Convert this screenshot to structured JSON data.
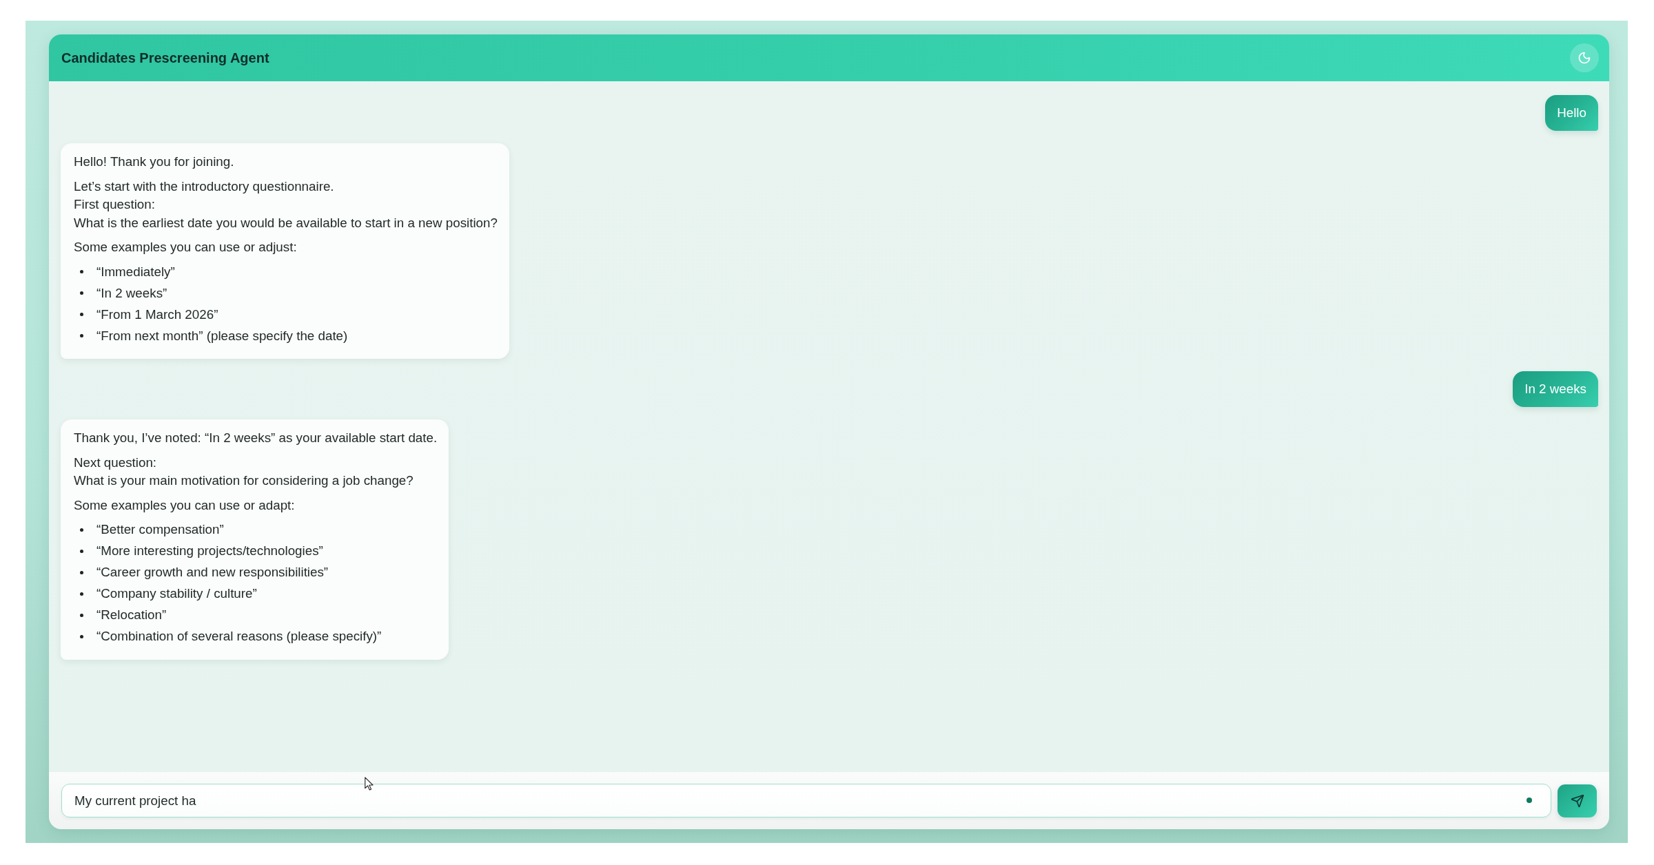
{
  "header": {
    "title": "Candidates Prescreening Agent"
  },
  "messages": [
    {
      "kind": "user",
      "text": "Hello"
    },
    {
      "kind": "agent",
      "blocks": [
        {
          "kind": "paragraph",
          "lines": [
            "Hello! Thank you for joining."
          ]
        },
        {
          "kind": "paragraph",
          "lines": [
            "Let’s start with the introductory questionnaire.",
            "First question:",
            "What is the earliest date you would be available to start in a new position?"
          ]
        },
        {
          "kind": "paragraph",
          "lines": [
            "Some examples you can use or adjust:"
          ]
        },
        {
          "kind": "list",
          "items": [
            "“Immediately”",
            "“In 2 weeks”",
            "“From 1 March 2026”",
            "“From next month” (please specify the date)"
          ]
        }
      ]
    },
    {
      "kind": "user",
      "text": "In 2 weeks"
    },
    {
      "kind": "agent",
      "blocks": [
        {
          "kind": "paragraph",
          "lines": [
            "Thank you, I’ve noted: “In 2 weeks” as your available start date."
          ]
        },
        {
          "kind": "paragraph",
          "lines": [
            "Next question:",
            "What is your main motivation for considering a job change?"
          ]
        },
        {
          "kind": "paragraph",
          "lines": [
            "Some examples you can use or adapt:"
          ]
        },
        {
          "kind": "list",
          "items": [
            "“Better compensation”",
            "“More interesting projects/technologies”",
            "“Career growth and new responsibilities”",
            "“Company stability / culture”",
            "“Relocation”",
            "“Combination of several reasons (please specify)”"
          ]
        }
      ]
    }
  ],
  "composer": {
    "value": "My current project ha"
  }
}
